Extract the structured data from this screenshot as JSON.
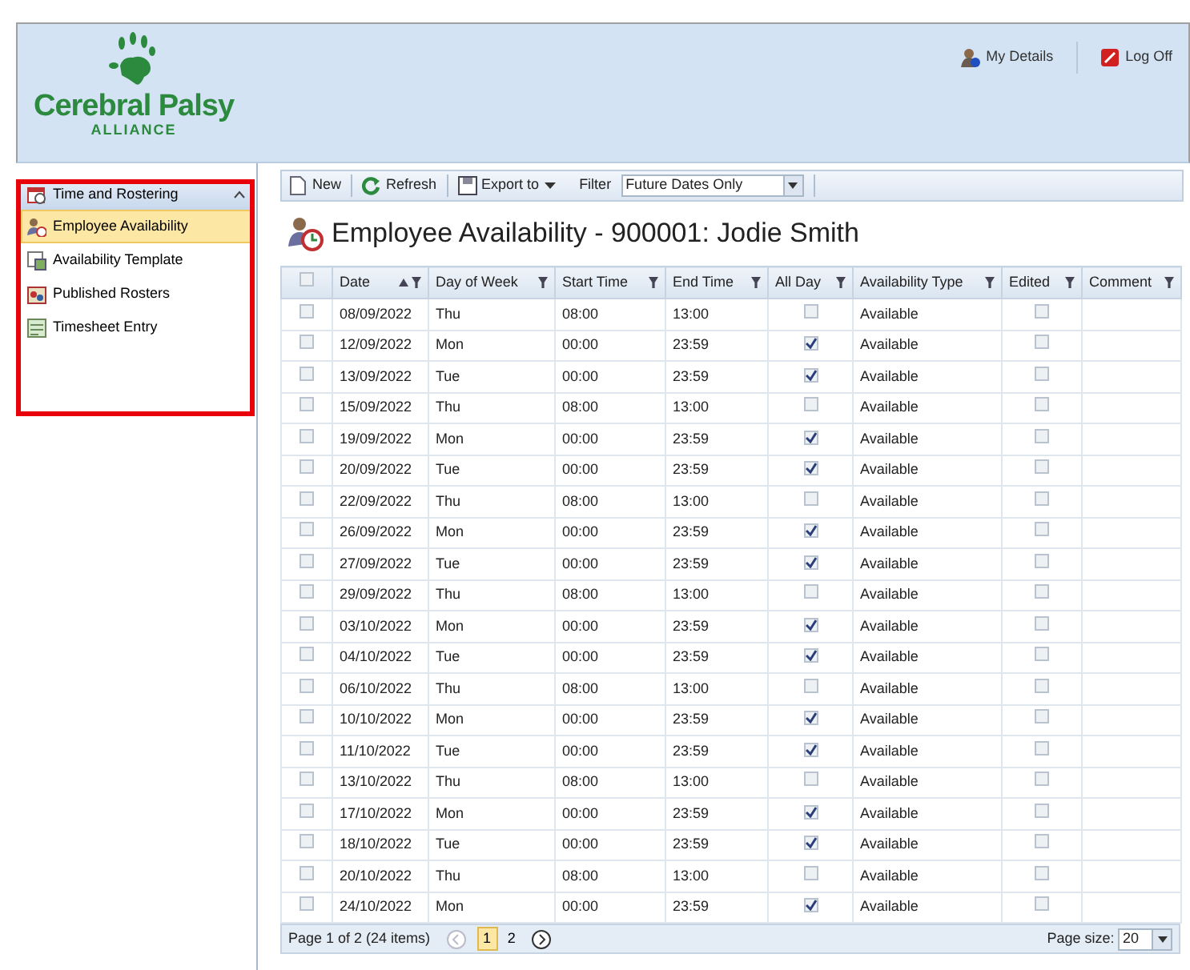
{
  "header": {
    "logo_text": "Cerebral Palsy",
    "logo_subtext": "ALLIANCE",
    "links": [
      {
        "label": "My Details",
        "kind": "user"
      },
      {
        "label": "Log Off",
        "kind": "logoff"
      }
    ]
  },
  "sidebar": {
    "group": {
      "label": "Time and Rostering",
      "expanded": true
    },
    "highlighted": true,
    "items": [
      {
        "label": "Employee Availability",
        "selected": true,
        "kind": "availability"
      },
      {
        "label": "Availability Template",
        "selected": false,
        "kind": "template"
      },
      {
        "label": "Published Rosters",
        "selected": false,
        "kind": "rosters"
      },
      {
        "label": "Timesheet Entry",
        "selected": false,
        "kind": "timesheet"
      }
    ]
  },
  "toolbar": {
    "buttons": [
      {
        "label": "New",
        "kind": "new"
      },
      {
        "label": "Refresh",
        "kind": "refresh"
      },
      {
        "label": "Export to",
        "kind": "export"
      }
    ],
    "filter_label": "Filter",
    "filter_value": "Future Dates Only"
  },
  "title": "Employee Availability - 900001: Jodie Smith",
  "table": {
    "select_all": false,
    "columns": [
      {
        "label": "Date",
        "sorted": true
      },
      {
        "label": "Day of Week",
        "sorted": false
      },
      {
        "label": "Start Time",
        "sorted": false
      },
      {
        "label": "End Time",
        "sorted": false
      },
      {
        "label": "All Day",
        "sorted": false
      },
      {
        "label": "Availability Type",
        "sorted": false
      },
      {
        "label": "Edited",
        "sorted": false
      },
      {
        "label": "Comment",
        "sorted": false
      }
    ],
    "rows": [
      {
        "selected": false,
        "date": "08/09/2022",
        "day": "Thu",
        "start": "08:00",
        "end": "13:00",
        "all_day": false,
        "type": "Available",
        "edited": false
      },
      {
        "selected": false,
        "date": "12/09/2022",
        "day": "Mon",
        "start": "00:00",
        "end": "23:59",
        "all_day": true,
        "type": "Available",
        "edited": false
      },
      {
        "selected": false,
        "date": "13/09/2022",
        "day": "Tue",
        "start": "00:00",
        "end": "23:59",
        "all_day": true,
        "type": "Available",
        "edited": false
      },
      {
        "selected": false,
        "date": "15/09/2022",
        "day": "Thu",
        "start": "08:00",
        "end": "13:00",
        "all_day": false,
        "type": "Available",
        "edited": false
      },
      {
        "selected": false,
        "date": "19/09/2022",
        "day": "Mon",
        "start": "00:00",
        "end": "23:59",
        "all_day": true,
        "type": "Available",
        "edited": false
      },
      {
        "selected": false,
        "date": "20/09/2022",
        "day": "Tue",
        "start": "00:00",
        "end": "23:59",
        "all_day": true,
        "type": "Available",
        "edited": false
      },
      {
        "selected": false,
        "date": "22/09/2022",
        "day": "Thu",
        "start": "08:00",
        "end": "13:00",
        "all_day": false,
        "type": "Available",
        "edited": false
      },
      {
        "selected": false,
        "date": "26/09/2022",
        "day": "Mon",
        "start": "00:00",
        "end": "23:59",
        "all_day": true,
        "type": "Available",
        "edited": false
      },
      {
        "selected": false,
        "date": "27/09/2022",
        "day": "Tue",
        "start": "00:00",
        "end": "23:59",
        "all_day": true,
        "type": "Available",
        "edited": false
      },
      {
        "selected": false,
        "date": "29/09/2022",
        "day": "Thu",
        "start": "08:00",
        "end": "13:00",
        "all_day": false,
        "type": "Available",
        "edited": false
      },
      {
        "selected": false,
        "date": "03/10/2022",
        "day": "Mon",
        "start": "00:00",
        "end": "23:59",
        "all_day": true,
        "type": "Available",
        "edited": false
      },
      {
        "selected": false,
        "date": "04/10/2022",
        "day": "Tue",
        "start": "00:00",
        "end": "23:59",
        "all_day": true,
        "type": "Available",
        "edited": false
      },
      {
        "selected": false,
        "date": "06/10/2022",
        "day": "Thu",
        "start": "08:00",
        "end": "13:00",
        "all_day": false,
        "type": "Available",
        "edited": false
      },
      {
        "selected": false,
        "date": "10/10/2022",
        "day": "Mon",
        "start": "00:00",
        "end": "23:59",
        "all_day": true,
        "type": "Available",
        "edited": false
      },
      {
        "selected": false,
        "date": "11/10/2022",
        "day": "Tue",
        "start": "00:00",
        "end": "23:59",
        "all_day": true,
        "type": "Available",
        "edited": false
      },
      {
        "selected": false,
        "date": "13/10/2022",
        "day": "Thu",
        "start": "08:00",
        "end": "13:00",
        "all_day": false,
        "type": "Available",
        "edited": false
      },
      {
        "selected": false,
        "date": "17/10/2022",
        "day": "Mon",
        "start": "00:00",
        "end": "23:59",
        "all_day": true,
        "type": "Available",
        "edited": false
      },
      {
        "selected": false,
        "date": "18/10/2022",
        "day": "Tue",
        "start": "00:00",
        "end": "23:59",
        "all_day": true,
        "type": "Available",
        "edited": false
      },
      {
        "selected": false,
        "date": "20/10/2022",
        "day": "Thu",
        "start": "08:00",
        "end": "13:00",
        "all_day": false,
        "type": "Available",
        "edited": false
      },
      {
        "selected": false,
        "date": "24/10/2022",
        "day": "Mon",
        "start": "00:00",
        "end": "23:59",
        "all_day": true,
        "type": "Available",
        "edited": false
      }
    ]
  },
  "pager": {
    "summary": "Page 1 of 2 (24 items)",
    "pages": [
      {
        "label": "1",
        "selected": true
      },
      {
        "label": "2",
        "selected": false
      }
    ],
    "page_size_label": "Page size:",
    "page_size": "20"
  }
}
